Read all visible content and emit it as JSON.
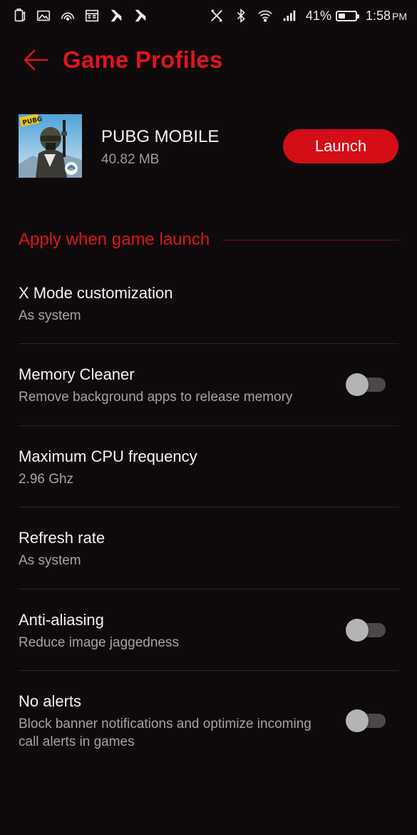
{
  "status_bar": {
    "battery_percent": "41%",
    "battery_level": 0.41,
    "time": "1:58",
    "time_suffix": "PM",
    "left_icons": [
      "clipboard-icon",
      "image-icon",
      "hotspot-icon",
      "calendar-icon",
      "app-notification-icon",
      "app-notification-icon"
    ],
    "right_icons": [
      "x-app-icon",
      "bluetooth-icon",
      "wifi-icon",
      "signal-icon"
    ]
  },
  "header": {
    "title": "Game Profiles",
    "back_icon": "arrow-left-icon"
  },
  "game": {
    "name": "PUBG MOBILE",
    "size": "40.82 MB",
    "launch_label": "Launch",
    "thumbnail_badge": "PUBG"
  },
  "section": {
    "title": "Apply when game launch"
  },
  "settings": [
    {
      "title": "X Mode customization",
      "subtitle": "As system"
    },
    {
      "title": "Memory Cleaner",
      "subtitle": "Remove background apps to release memory",
      "toggle": false
    },
    {
      "title": "Maximum CPU frequency",
      "subtitle": "2.96 Ghz"
    },
    {
      "title": "Refresh rate",
      "subtitle": "As system"
    },
    {
      "title": "Anti-aliasing",
      "subtitle": "Reduce image jaggedness",
      "toggle": false
    },
    {
      "title": "No alerts",
      "subtitle": "Block banner notifications and optimize incoming call alerts in games",
      "toggle": false
    }
  ],
  "colors": {
    "accent": "#e0141c",
    "button": "#d40d16",
    "background": "#0e0a0b"
  }
}
